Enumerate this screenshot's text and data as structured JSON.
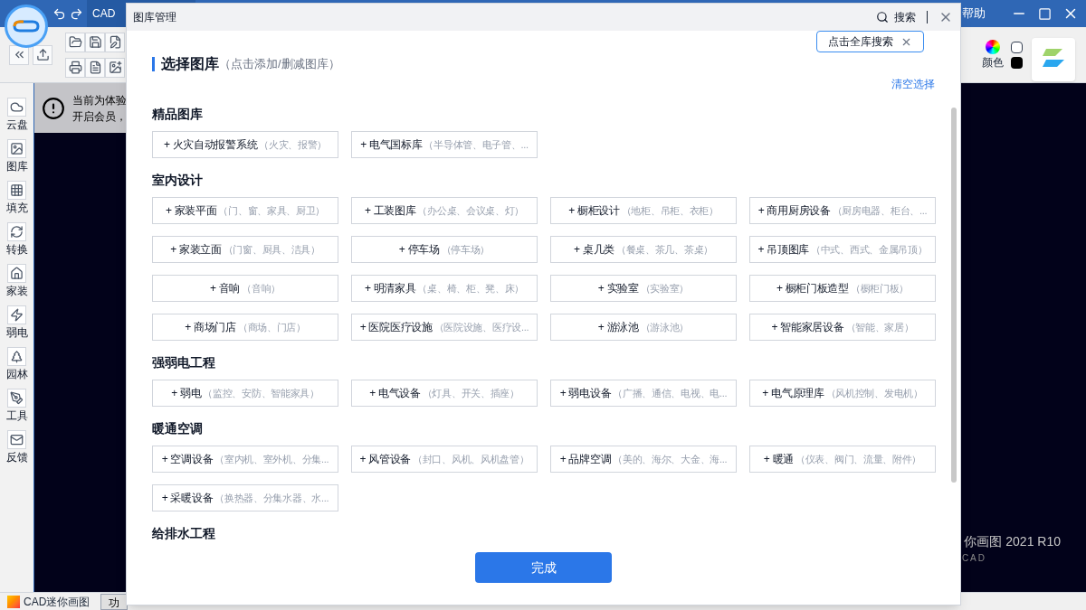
{
  "app": {
    "title": "CAD",
    "help_label": "帮助",
    "color_label": "颜色",
    "notice": [
      "当前为体验",
      "开启会员，"
    ],
    "sidebar": [
      {
        "label": "云盘"
      },
      {
        "label": "图库"
      },
      {
        "label": "填充"
      },
      {
        "label": "转换"
      },
      {
        "label": "家装"
      },
      {
        "label": "弱电"
      },
      {
        "label": "园林"
      },
      {
        "label": "工具"
      },
      {
        "label": "反馈"
      }
    ],
    "canvas_brand": "你画图 2021 R10",
    "canvas_brand_sub": "CAD",
    "status_bar": {
      "app_name": "CAD迷你画图",
      "tab": "功"
    }
  },
  "dialog": {
    "title": "图库管理",
    "search_label": "搜索",
    "search_tooltip": "点击全库搜索",
    "heading": "选择图库",
    "heading_hint": "（点击添加/删减图库）",
    "clear_link": "清空选择",
    "sections": [
      {
        "title": "精品图库",
        "items": [
          {
            "name": "+ 火灾自动报警系统",
            "hint": "（火灾、报警）"
          },
          {
            "name": "+ 电气国标库",
            "hint": "（半导体管、电子管、..."
          }
        ]
      },
      {
        "title": "室内设计",
        "items": [
          {
            "name": "+ 家装平面",
            "hint": "（门、窗、家具、厨卫）"
          },
          {
            "name": "+ 工装图库",
            "hint": "（办公桌、会议桌、灯）"
          },
          {
            "name": "+ 橱柜设计",
            "hint": "（地柜、吊柜、衣柜）"
          },
          {
            "name": "+ 商用厨房设备",
            "hint": "（厨房电器、柜台、..."
          },
          {
            "name": "+ 家装立面",
            "hint": "（门窗、厨具、洁具）"
          },
          {
            "name": "+ 停车场",
            "hint": "（停车场）"
          },
          {
            "name": "+ 桌几类",
            "hint": "（餐桌、茶几、茶桌）"
          },
          {
            "name": "+ 吊顶图库",
            "hint": "（中式、西式、金属吊顶）"
          },
          {
            "name": "+ 音响",
            "hint": "（音响）"
          },
          {
            "name": "+ 明清家具",
            "hint": "（桌、椅、柜、凳、床）"
          },
          {
            "name": "+ 实验室",
            "hint": "（实验室）"
          },
          {
            "name": "+ 橱柜门板造型",
            "hint": "（橱柜门板）"
          },
          {
            "name": "+ 商场门店",
            "hint": "（商场、门店）"
          },
          {
            "name": "+ 医院医疗设施",
            "hint": "（医院设施、医疗设..."
          },
          {
            "name": "+ 游泳池",
            "hint": "（游泳池）"
          },
          {
            "name": "+ 智能家居设备",
            "hint": "（智能、家居）"
          }
        ]
      },
      {
        "title": "强弱电工程",
        "items": [
          {
            "name": "+ 弱电",
            "hint": "（监控、安防、智能家具）"
          },
          {
            "name": "+ 电气设备",
            "hint": "（灯具、开关、插座）"
          },
          {
            "name": "+ 弱电设备",
            "hint": "（广播、通信、电视、电..."
          },
          {
            "name": "+ 电气原理库",
            "hint": "（风机控制、发电机）"
          }
        ]
      },
      {
        "title": "暖通空调",
        "items": [
          {
            "name": "+ 空调设备",
            "hint": "（室内机、室外机、分集..."
          },
          {
            "name": "+ 风管设备",
            "hint": "（封口、风机、风机盘管）"
          },
          {
            "name": "+ 品牌空调",
            "hint": "（美的、海尔、大金、海..."
          },
          {
            "name": "+ 暖通",
            "hint": "（仪表、阀门、流量、附件）"
          },
          {
            "name": "+ 采暖设备",
            "hint": "（换热器、分集水器、水..."
          }
        ]
      },
      {
        "title": "给排水工程"
      }
    ],
    "done_button": "完成"
  }
}
